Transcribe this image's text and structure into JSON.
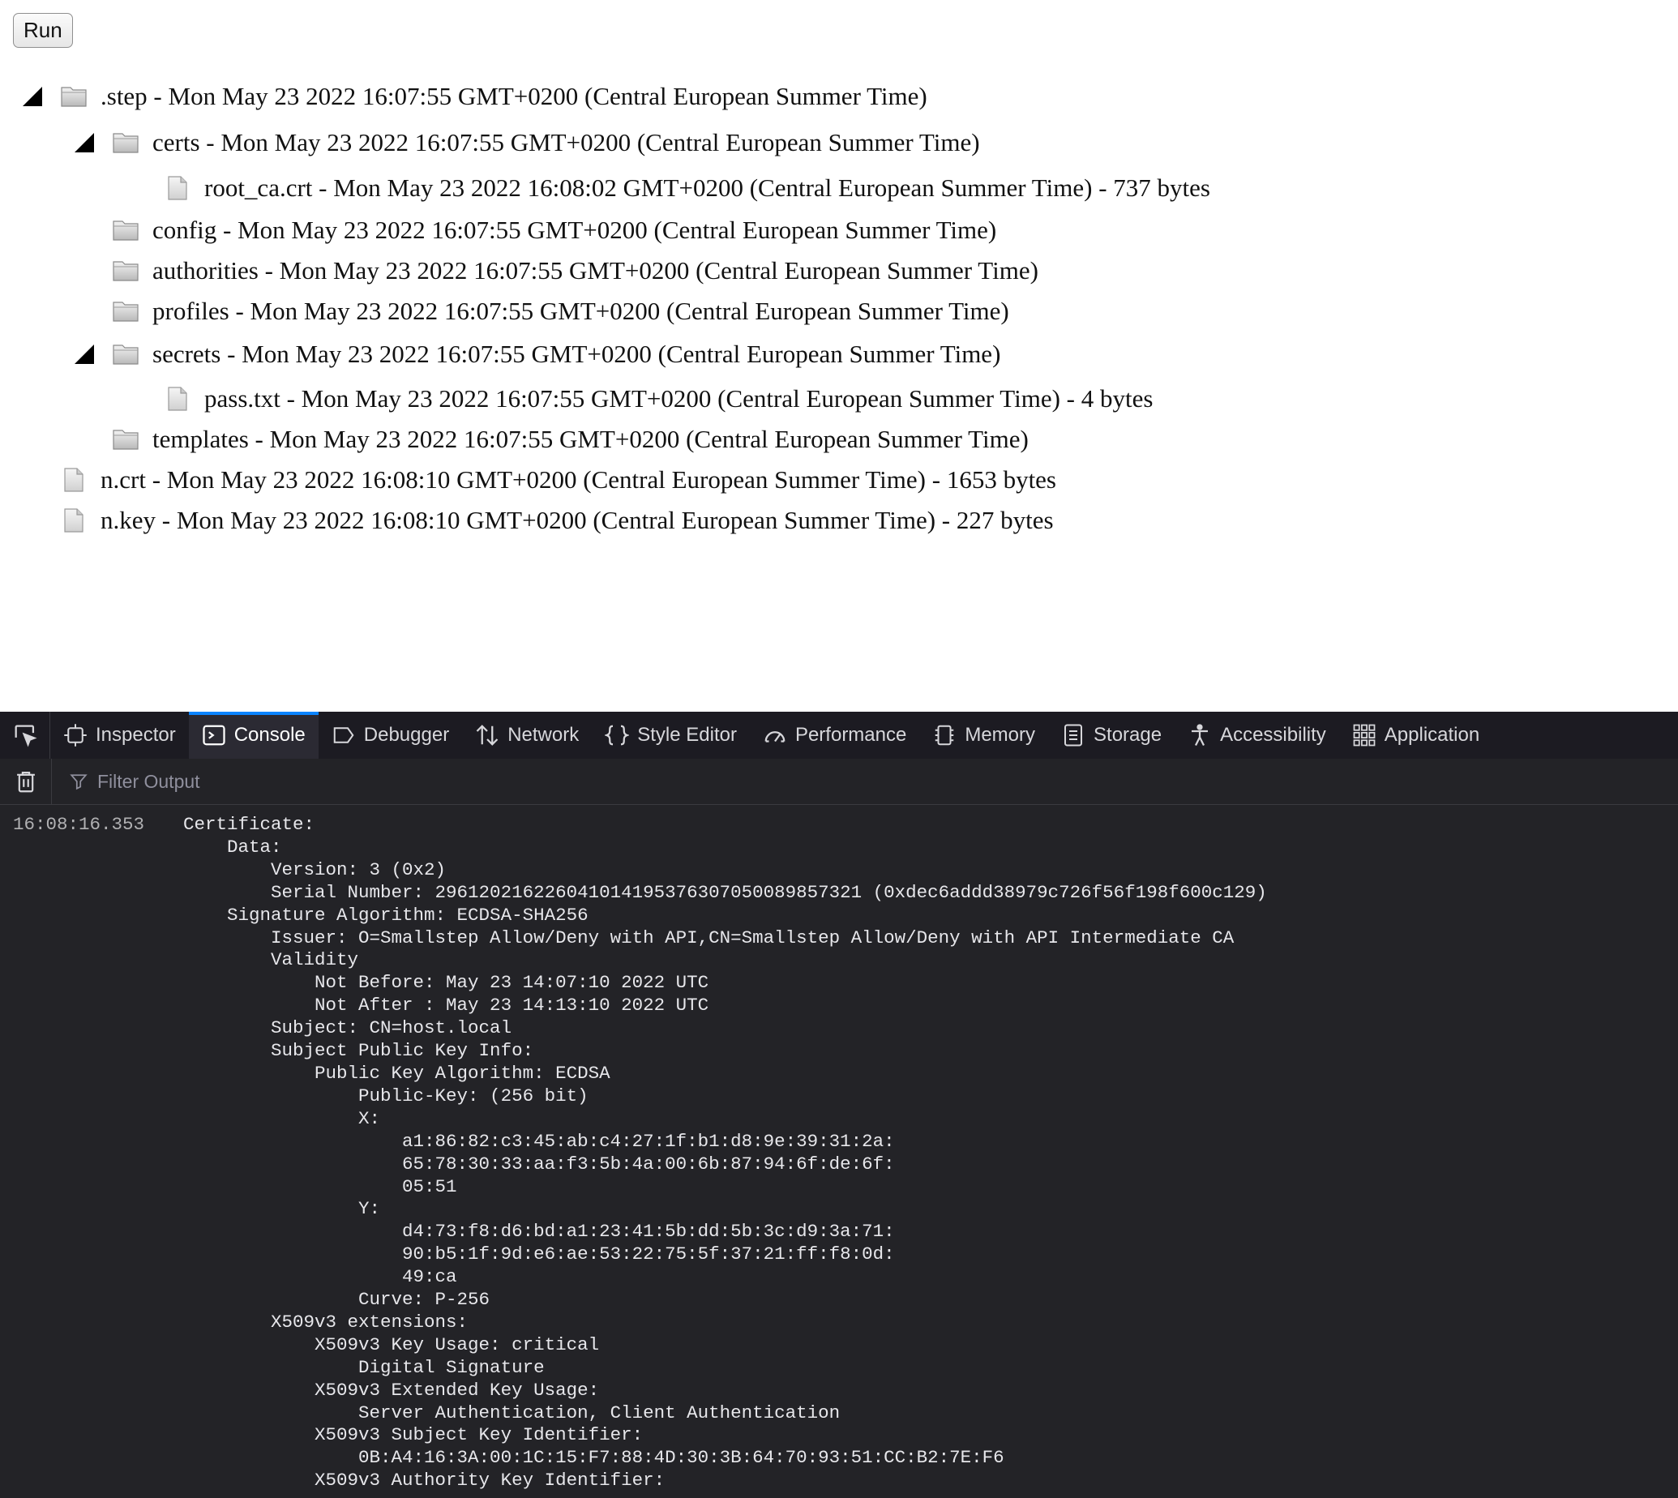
{
  "run_label": "Run",
  "tree": [
    {
      "depth": 0,
      "kind": "folder",
      "expanded": true,
      "label": ".step - Mon May 23 2022 16:07:55 GMT+0200 (Central European Summer Time)"
    },
    {
      "depth": 1,
      "kind": "folder",
      "expanded": true,
      "label": "certs - Mon May 23 2022 16:07:55 GMT+0200 (Central European Summer Time)"
    },
    {
      "depth": 2,
      "kind": "file",
      "expanded": false,
      "label": "root_ca.crt - Mon May 23 2022 16:08:02 GMT+0200 (Central European Summer Time) - 737 bytes"
    },
    {
      "depth": 1,
      "kind": "folder",
      "expanded": false,
      "label": "config - Mon May 23 2022 16:07:55 GMT+0200 (Central European Summer Time)"
    },
    {
      "depth": 1,
      "kind": "folder",
      "expanded": false,
      "label": "authorities - Mon May 23 2022 16:07:55 GMT+0200 (Central European Summer Time)"
    },
    {
      "depth": 1,
      "kind": "folder",
      "expanded": false,
      "label": "profiles - Mon May 23 2022 16:07:55 GMT+0200 (Central European Summer Time)"
    },
    {
      "depth": 1,
      "kind": "folder",
      "expanded": true,
      "label": "secrets - Mon May 23 2022 16:07:55 GMT+0200 (Central European Summer Time)"
    },
    {
      "depth": 2,
      "kind": "file",
      "expanded": false,
      "label": "pass.txt - Mon May 23 2022 16:07:55 GMT+0200 (Central European Summer Time) - 4 bytes"
    },
    {
      "depth": 1,
      "kind": "folder",
      "expanded": false,
      "label": "templates - Mon May 23 2022 16:07:55 GMT+0200 (Central European Summer Time)"
    },
    {
      "depth": 0,
      "kind": "file",
      "expanded": false,
      "label": "n.crt - Mon May 23 2022 16:08:10 GMT+0200 (Central European Summer Time) - 1653 bytes"
    },
    {
      "depth": 0,
      "kind": "file",
      "expanded": false,
      "label": "n.key - Mon May 23 2022 16:08:10 GMT+0200 (Central European Summer Time) - 227 bytes"
    }
  ],
  "devtools": {
    "tabs": [
      {
        "label": "Inspector",
        "icon": "inspector-icon",
        "selected": false
      },
      {
        "label": "Console",
        "icon": "console-icon",
        "selected": true
      },
      {
        "label": "Debugger",
        "icon": "debugger-icon",
        "selected": false
      },
      {
        "label": "Network",
        "icon": "network-icon",
        "selected": false
      },
      {
        "label": "Style Editor",
        "icon": "style-editor-icon",
        "selected": false
      },
      {
        "label": "Performance",
        "icon": "performance-icon",
        "selected": false
      },
      {
        "label": "Memory",
        "icon": "memory-icon",
        "selected": false
      },
      {
        "label": "Storage",
        "icon": "storage-icon",
        "selected": false
      },
      {
        "label": "Accessibility",
        "icon": "accessibility-icon",
        "selected": false
      },
      {
        "label": "Application",
        "icon": "application-icon",
        "selected": false
      }
    ],
    "filter_placeholder": "Filter Output",
    "console": {
      "timestamp": "16:08:16.353",
      "message": "Certificate:\n    Data:\n        Version: 3 (0x2)\n        Serial Number: 296120216226041014195376307050089857321 (0xdec6addd38979c726f56f198f600c129)\n    Signature Algorithm: ECDSA-SHA256\n        Issuer: O=Smallstep Allow/Deny with API,CN=Smallstep Allow/Deny with API Intermediate CA\n        Validity\n            Not Before: May 23 14:07:10 2022 UTC\n            Not After : May 23 14:13:10 2022 UTC\n        Subject: CN=host.local\n        Subject Public Key Info:\n            Public Key Algorithm: ECDSA\n                Public-Key: (256 bit)\n                X:\n                    a1:86:82:c3:45:ab:c4:27:1f:b1:d8:9e:39:31:2a:\n                    65:78:30:33:aa:f3:5b:4a:00:6b:87:94:6f:de:6f:\n                    05:51\n                Y:\n                    d4:73:f8:d6:bd:a1:23:41:5b:dd:5b:3c:d9:3a:71:\n                    90:b5:1f:9d:e6:ae:53:22:75:5f:37:21:ff:f8:0d:\n                    49:ca\n                Curve: P-256\n        X509v3 extensions:\n            X509v3 Key Usage: critical\n                Digital Signature\n            X509v3 Extended Key Usage:\n                Server Authentication, Client Authentication\n            X509v3 Subject Key Identifier:\n                0B:A4:16:3A:00:1C:15:F7:88:4D:30:3B:64:70:93:51:CC:B2:7E:F6\n            X509v3 Authority Key Identifier:"
    }
  }
}
